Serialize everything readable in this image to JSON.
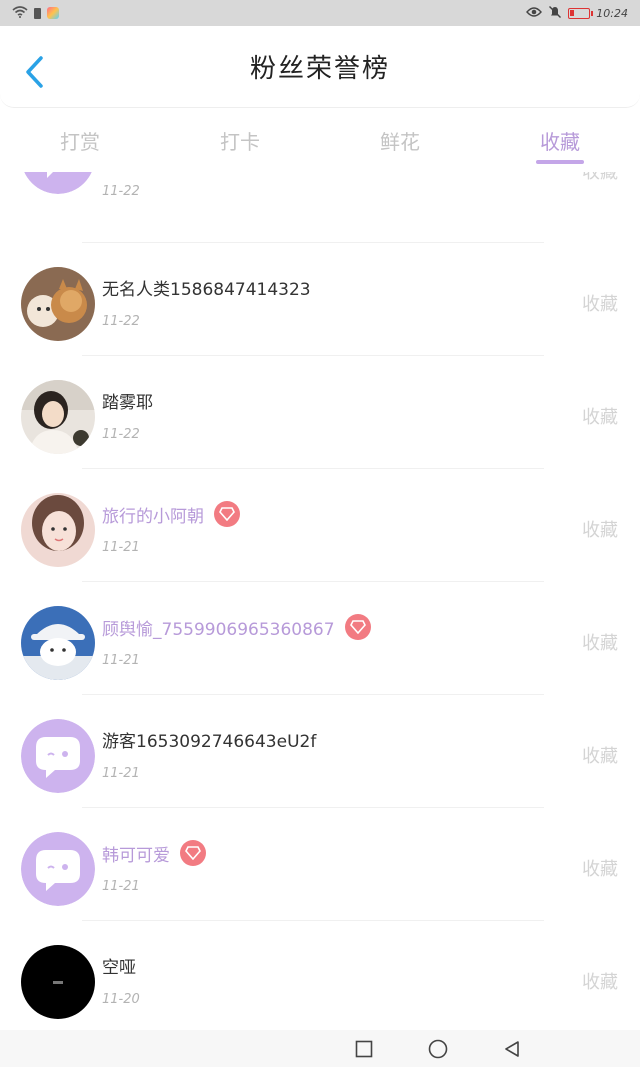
{
  "status_bar": {
    "time": "10:24"
  },
  "header": {
    "title": "粉丝荣誉榜"
  },
  "tabs": [
    {
      "label": "打赏",
      "active": false
    },
    {
      "label": "打卡",
      "active": false
    },
    {
      "label": "鲜花",
      "active": false
    },
    {
      "label": "收藏",
      "active": true
    }
  ],
  "fans": [
    {
      "name": "",
      "date": "11-22",
      "action": "收藏",
      "vip": false,
      "avatar": "default-chat-bubble"
    },
    {
      "name": "无名人类1586847414323",
      "date": "11-22",
      "action": "收藏",
      "vip": false,
      "avatar": "cats-photo"
    },
    {
      "name": "踏雾耶",
      "date": "11-22",
      "action": "收藏",
      "vip": false,
      "avatar": "girl-photo"
    },
    {
      "name": "旅行的小阿朝",
      "date": "11-21",
      "action": "收藏",
      "vip": true,
      "avatar": "girl-closeup-photo"
    },
    {
      "name": "顾舆愉_7559906965360867",
      "date": "11-21",
      "action": "收藏",
      "vip": true,
      "avatar": "cat-in-hat-photo"
    },
    {
      "name": "游客1653092746643eU2f",
      "date": "11-21",
      "action": "收藏",
      "vip": false,
      "avatar": "default-chat-bubble"
    },
    {
      "name": "韩可可爱",
      "date": "11-21",
      "action": "收藏",
      "vip": true,
      "avatar": "default-chat-bubble"
    },
    {
      "name": "空哑",
      "date": "11-20",
      "action": "收藏",
      "vip": false,
      "avatar": "black-photo"
    }
  ],
  "colors": {
    "accent": "#b79ad9",
    "vip_badge": "#f27b82",
    "back_arrow": "#2aa2e6",
    "default_avatar": "#cdb3ee"
  }
}
